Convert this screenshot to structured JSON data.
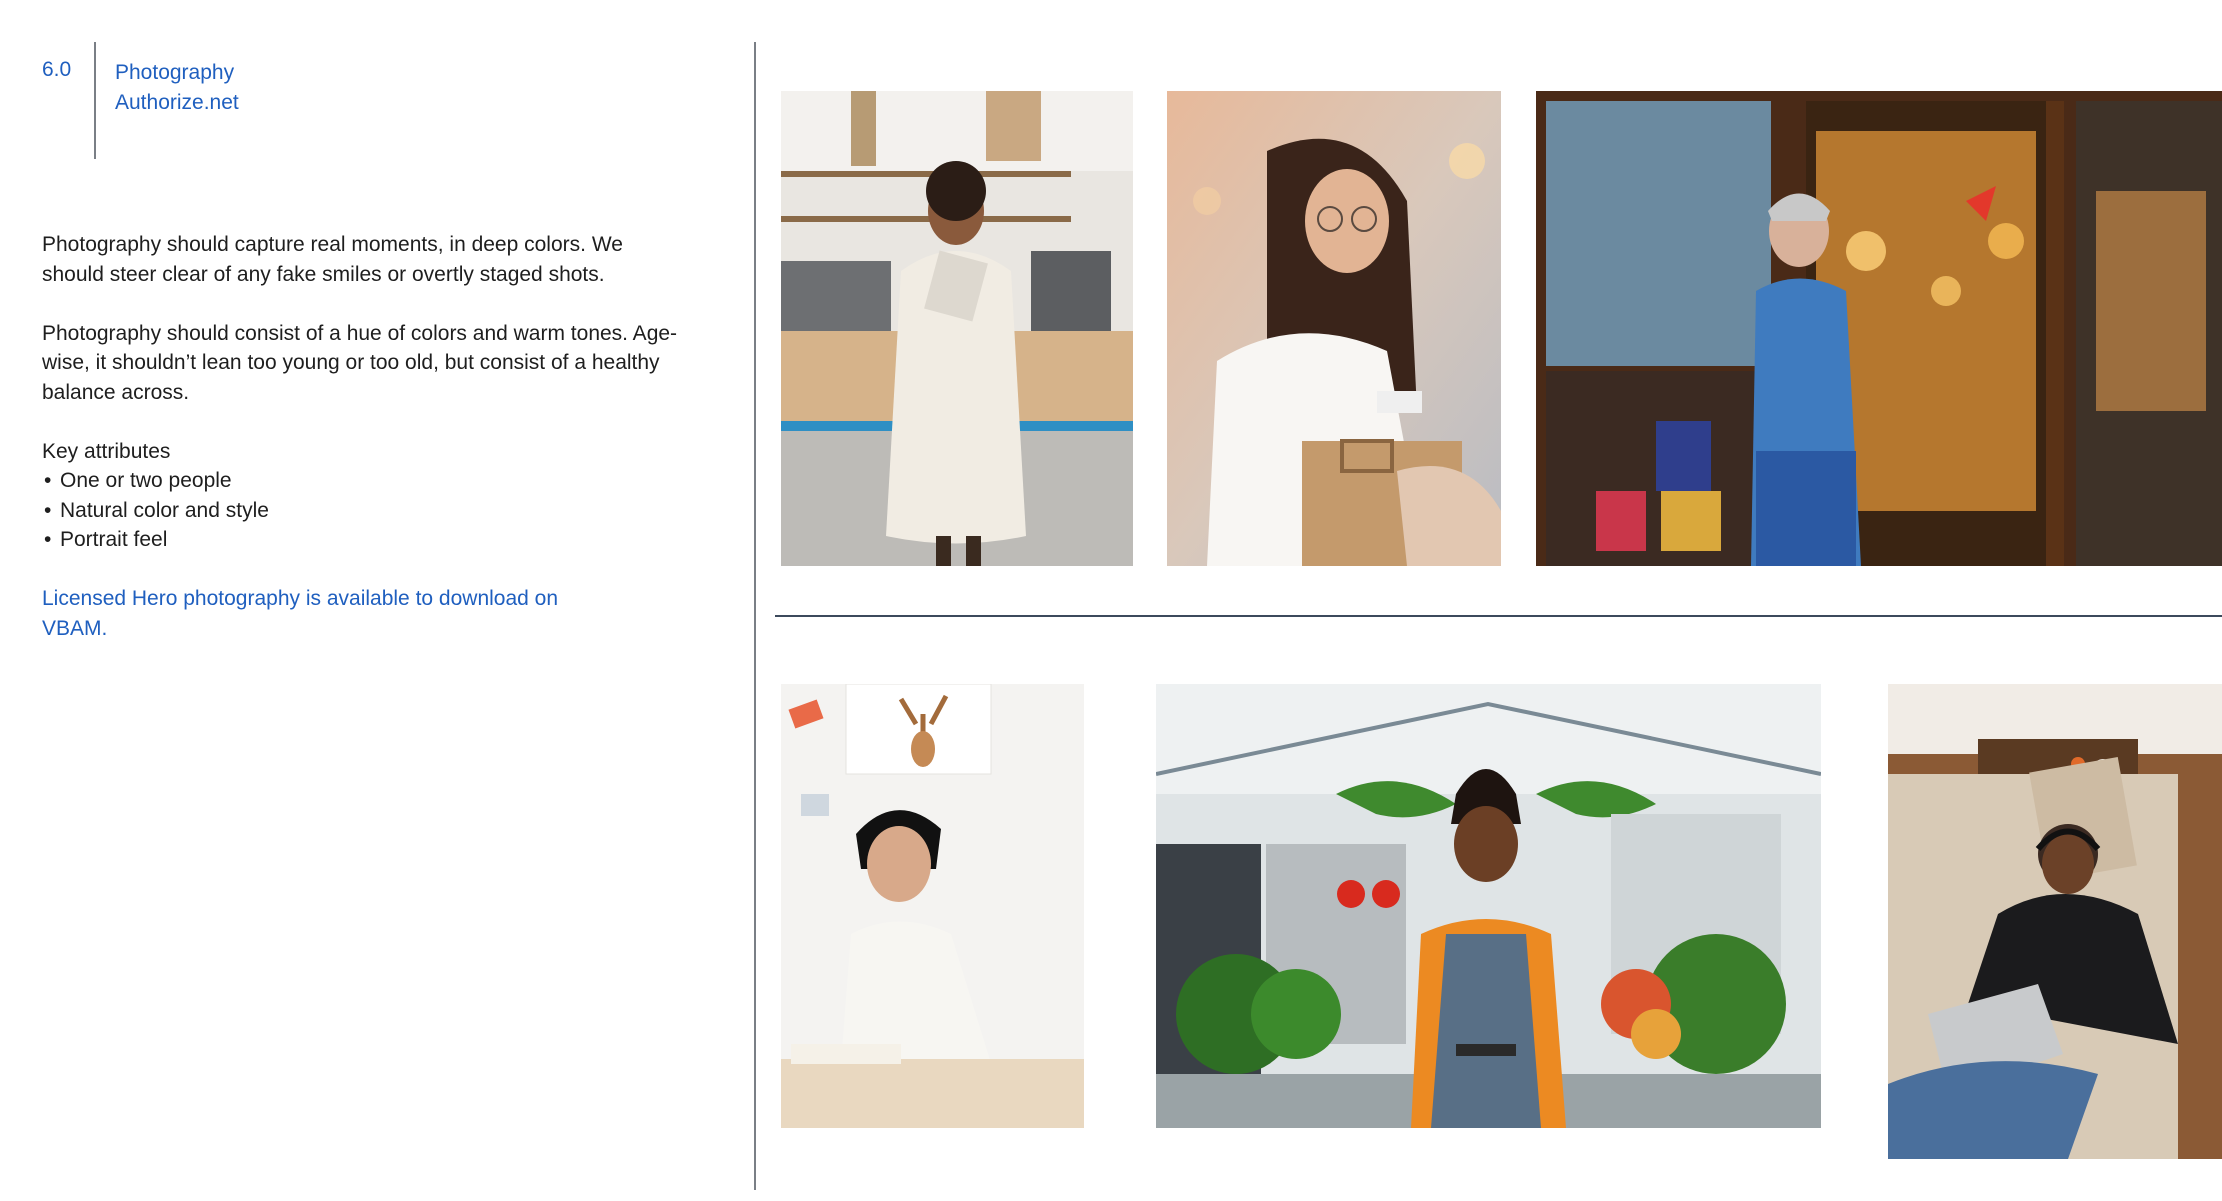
{
  "header": {
    "section_number": "6.0",
    "title": "Photography",
    "subtitle": "Authorize.net"
  },
  "body": {
    "paragraph_1": "Photography should capture real moments, in deep colors. We should steer clear of any fake smiles or overtly staged shots.",
    "paragraph_2": "Photography should consist of a hue of colors and warm tones. Age-wise, it shouldn’t lean too young or too old, but consist of a healthy balance across.",
    "attributes_heading": "Key attributes",
    "attributes": [
      "One or two people",
      "Natural color and style",
      "Portrait feel"
    ],
    "licensed_note": "Licensed Hero photography is available to download on VBAM."
  },
  "colors": {
    "accent_blue": "#1f5fbf",
    "body_text": "#1e1e1e",
    "divider": "#7a7f86"
  },
  "photos": [
    {
      "subject": "woman-in-cream-dress-in-cafe-photo"
    },
    {
      "subject": "woman-with-glasses-looking-at-phone-photo"
    },
    {
      "subject": "gray-haired-woman-in-denim-at-restaurant-door-photo"
    },
    {
      "subject": "woman-on-phone-at-desk-photo"
    },
    {
      "subject": "smiling-man-in-apron-in-greenhouse-photo"
    },
    {
      "subject": "man-with-headphones-and-laptop-on-couch-photo"
    }
  ]
}
